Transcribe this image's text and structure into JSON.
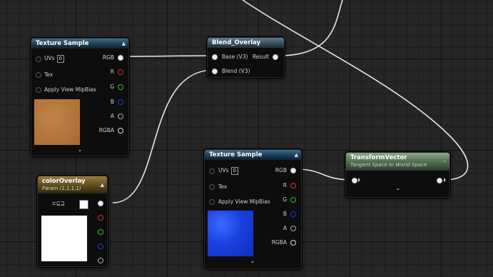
{
  "colors": {
    "pin_red": "#d23030",
    "pin_green": "#30c030",
    "pin_blue": "#2040d0",
    "pin_white": "#e8e8e8",
    "wire": "#e6e6e6"
  },
  "nodes": {
    "texture_sample_1": {
      "title": "Texture Sample",
      "uvs_label": "UVs",
      "uvs_value": "0",
      "tex_label": "Tex",
      "mip_label": "Apply View MipBias",
      "outputs": [
        "RGB",
        "R",
        "G",
        "B",
        "A",
        "RGBA"
      ],
      "expand_icon": "chevron-down-icon",
      "preview": "orange-texture"
    },
    "blend_overlay": {
      "title": "Blend_Overlay",
      "base_label": "Base (V3)",
      "blend_label": "Blend (V3)",
      "result_label": "Result"
    },
    "color_overlay": {
      "title": "colorOverlay",
      "subtitle": "Param (1,1,1,1)",
      "expand_icon": "chevron-up-icon"
    },
    "texture_sample_2": {
      "title": "Texture Sample",
      "uvs_label": "UVs",
      "uvs_value": "0",
      "tex_label": "Tex",
      "mip_label": "Apply View MipBias",
      "outputs": [
        "RGB",
        "R",
        "G",
        "B",
        "A",
        "RGBA"
      ],
      "expand_icon": "chevron-down-icon",
      "preview": "blue-normal-texture"
    },
    "transform_vector": {
      "title": "TransformVector",
      "subtitle": "Tangent Space to World Space",
      "expand_icon": "chevron-down-icon"
    }
  }
}
